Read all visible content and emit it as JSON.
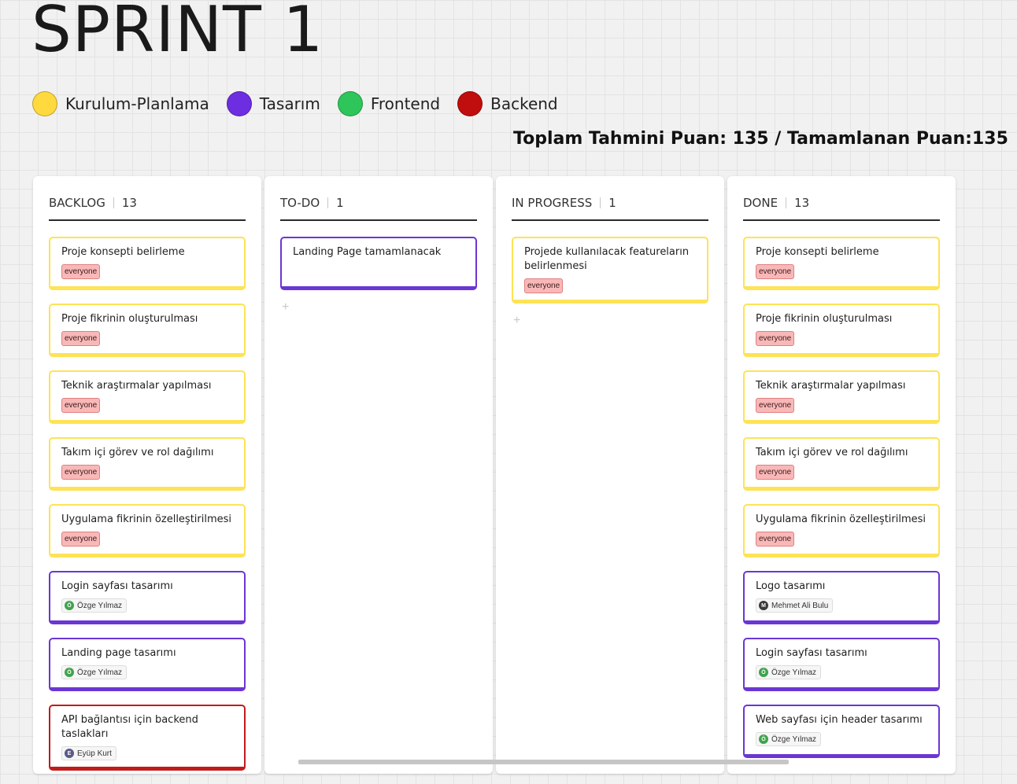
{
  "board": {
    "title": "SPRINT 1",
    "summary": "Toplam Tahmini Puan: 135 / Tamamlanan Puan:135"
  },
  "legend": [
    {
      "label": "Kurulum-Planlama",
      "color": "#ffd93d"
    },
    {
      "label": "Tasarım",
      "color": "#6c2ee0"
    },
    {
      "label": "Frontend",
      "color": "#2ec55a"
    },
    {
      "label": "Backend",
      "color": "#c00d0d"
    }
  ],
  "colors": {
    "yellow": "#fde356",
    "purple": "#6a36d4",
    "red": "#c21b1b",
    "green_avatar": "#3fa34d",
    "dark_avatar": "#3a3a3a",
    "blue_avatar": "#5a5a8a"
  },
  "columns": [
    {
      "name": "BACKLOG",
      "count": "13",
      "cards": [
        {
          "text": "Proje konsepti belirleme",
          "color": "yellow",
          "tag": "everyone"
        },
        {
          "text": "Proje fikrinin oluşturulması",
          "color": "yellow",
          "tag": "everyone"
        },
        {
          "text": "Teknik araştırmalar yapılması",
          "color": "yellow",
          "tag": "everyone"
        },
        {
          "text": "Takım içi görev ve rol dağılımı",
          "color": "yellow",
          "tag": "everyone"
        },
        {
          "text": "Uygulama fikrinin özelleştirilmesi",
          "color": "yellow",
          "tag": "everyone"
        },
        {
          "text": "Login sayfası tasarımı",
          "color": "purple",
          "assignee": "Özge Yılmaz",
          "initial": "Ö",
          "avatar": "green_avatar"
        },
        {
          "text": "Landing page tasarımı",
          "color": "purple",
          "assignee": "Özge Yılmaz",
          "initial": "Ö",
          "avatar": "green_avatar"
        },
        {
          "text": "API bağlantısı için backend taslakları",
          "color": "red",
          "assignee": "Eyüp Kurt",
          "initial": "E",
          "avatar": "blue_avatar"
        }
      ],
      "add": ""
    },
    {
      "name": "TO-DO",
      "count": "1",
      "cards": [
        {
          "text": "Landing Page tamamlanacak",
          "color": "purple"
        }
      ],
      "add": "+"
    },
    {
      "name": "IN PROGRESS",
      "count": "1",
      "cards": [
        {
          "text": "Projede kullanılacak featureların belirlenmesi",
          "color": "yellow",
          "tag": "everyone"
        }
      ],
      "add": "+"
    },
    {
      "name": "DONE",
      "count": "13",
      "cards": [
        {
          "text": "Proje konsepti belirleme",
          "color": "yellow",
          "tag": "everyone"
        },
        {
          "text": "Proje fikrinin oluşturulması",
          "color": "yellow",
          "tag": "everyone"
        },
        {
          "text": "Teknik araştırmalar yapılması",
          "color": "yellow",
          "tag": "everyone"
        },
        {
          "text": "Takım içi görev ve rol dağılımı",
          "color": "yellow",
          "tag": "everyone"
        },
        {
          "text": "Uygulama fikrinin özelleştirilmesi",
          "color": "yellow",
          "tag": "everyone"
        },
        {
          "text": "Logo tasarımı",
          "color": "purple",
          "assignee": "Mehmet Ali Bulu",
          "initial": "M",
          "avatar": "dark_avatar"
        },
        {
          "text": "Login sayfası tasarımı",
          "color": "purple",
          "assignee": "Özge Yılmaz",
          "initial": "Ö",
          "avatar": "green_avatar"
        },
        {
          "text": "Web sayfası için header tasarımı",
          "color": "purple",
          "assignee": "Özge Yılmaz",
          "initial": "Ö",
          "avatar": "green_avatar"
        }
      ],
      "add": ""
    }
  ]
}
